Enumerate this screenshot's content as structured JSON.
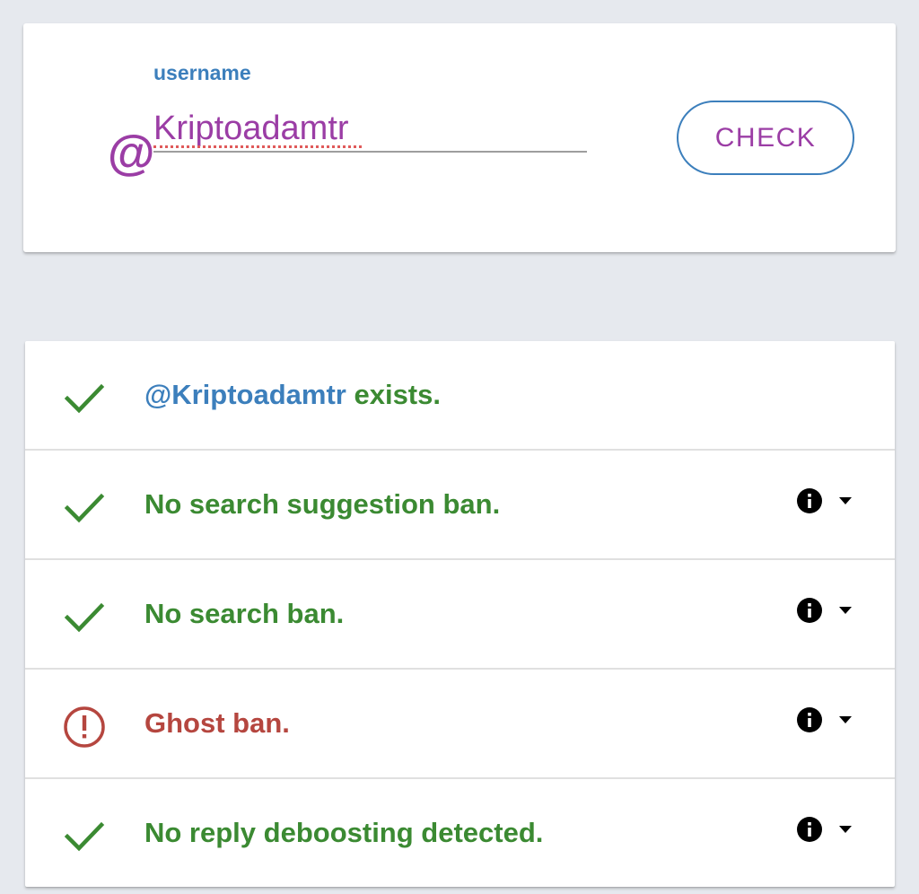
{
  "colors": {
    "accent_purple": "#9b3da5",
    "accent_blue": "#3c7fbc",
    "success_green": "#3b8a32",
    "danger_red": "#b5463f",
    "page_background": "#e6e9ee"
  },
  "search": {
    "field_label": "username",
    "at_symbol": "@",
    "value": "Kriptoadamtr",
    "check_button_label": "CHECK"
  },
  "results": [
    {
      "status": "success",
      "icon": "check-icon",
      "username": "@Kriptoadamtr",
      "text": " exists.",
      "has_details": false
    },
    {
      "status": "success",
      "icon": "check-icon",
      "text": "No search suggestion ban.",
      "has_details": true
    },
    {
      "status": "success",
      "icon": "check-icon",
      "text": "No search ban.",
      "has_details": true
    },
    {
      "status": "warning",
      "icon": "alert-circle-icon",
      "text": "Ghost ban.",
      "has_details": true
    },
    {
      "status": "success",
      "icon": "check-icon",
      "text": "No reply deboosting detected.",
      "has_details": true
    }
  ]
}
